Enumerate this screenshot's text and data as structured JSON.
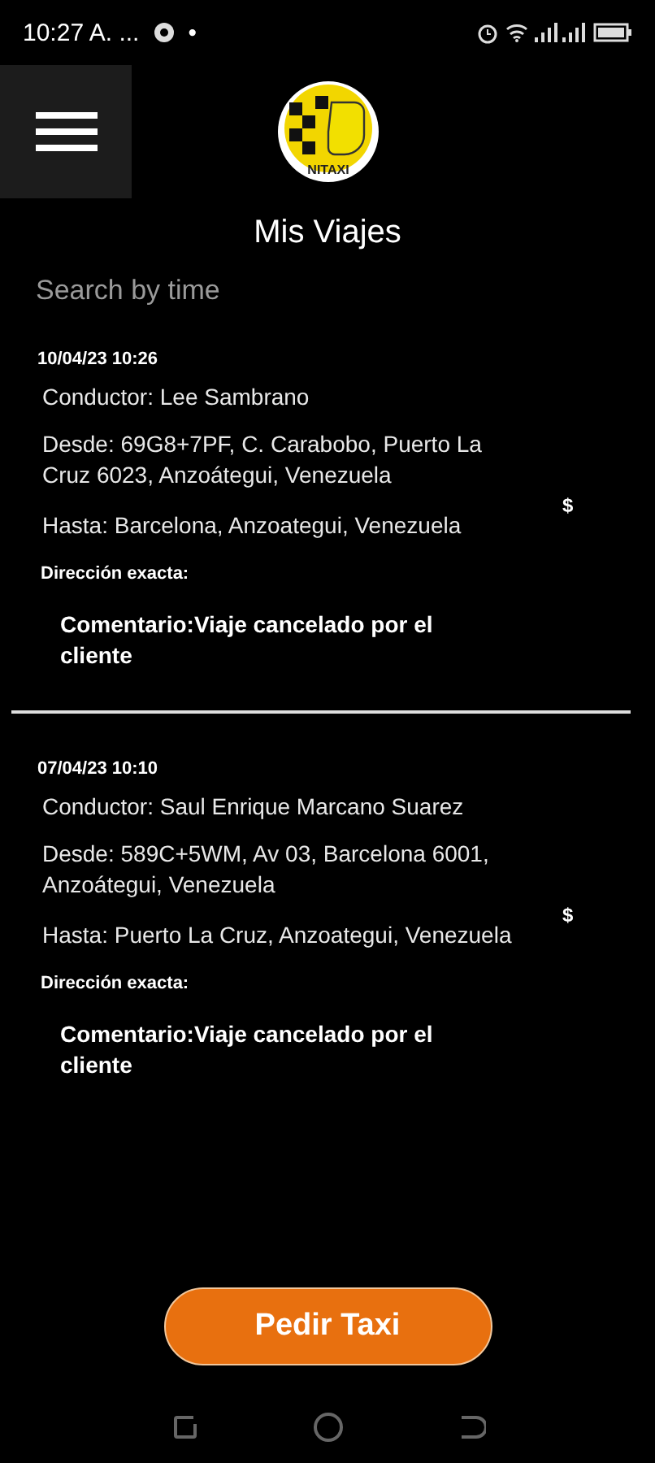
{
  "status_bar": {
    "time": "10:27 A. ...",
    "dot": "•"
  },
  "header": {
    "logo_text": "NITAXI"
  },
  "title": "Mis Viajes",
  "search": {
    "placeholder": "Search by time"
  },
  "trips": [
    {
      "date": "10/04/23 10:26",
      "driver": "Conductor: Lee Sambrano",
      "from": "Desde: 69G8+7PF, C. Carabobo, Puerto La Cruz 6023, Anzoátegui, Venezuela",
      "to": "Hasta: Barcelona, Anzoategui, Venezuela",
      "price": "$",
      "exact_address": "Dirección exacta:",
      "comment": "Comentario:Viaje cancelado por el cliente"
    },
    {
      "date": "07/04/23 10:10",
      "driver": "Conductor: Saul Enrique Marcano Suarez",
      "from": "Desde: 589C+5WM, Av 03, Barcelona 6001, Anzoátegui, Venezuela",
      "to": "Hasta: Puerto La Cruz, Anzoategui, Venezuela",
      "price": "$",
      "exact_address": "Dirección exacta:",
      "comment": "Comentario:Viaje cancelado por el cliente"
    }
  ],
  "action_button": "Pedir Taxi"
}
